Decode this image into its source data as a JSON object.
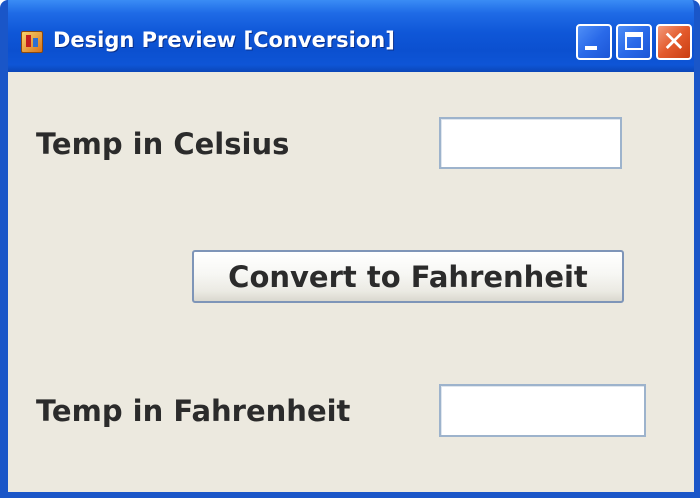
{
  "window": {
    "title": "Design Preview [Conversion]",
    "icon": "java-app-icon",
    "controls": {
      "minimize": "minimize-icon",
      "maximize": "maximize-icon",
      "close": "close-icon",
      "close_glyph": "✕"
    },
    "colors": {
      "titlebar": "#0b50d0",
      "client": "#ece9df",
      "close_button": "#e35a2c"
    }
  },
  "form": {
    "celsius_label": "Temp in Celsius",
    "celsius_value": "",
    "convert_button_label": "Convert to Fahrenheit",
    "fahrenheit_label": "Temp in Fahrenheit",
    "fahrenheit_value": ""
  }
}
